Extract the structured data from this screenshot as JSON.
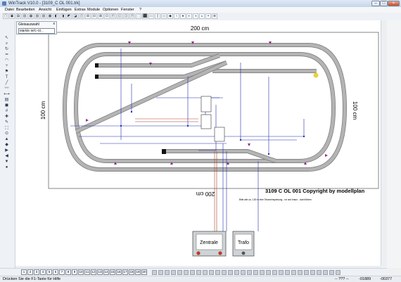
{
  "window": {
    "title": "WinTrack V10.0 - [3109_C OL 001.trk]"
  },
  "menu": [
    "Datei",
    "Bearbeiten",
    "Ansicht",
    "Einfügen",
    "Extras",
    "Module",
    "Optionen",
    "Fenster",
    "?"
  ],
  "panel": {
    "title": "Gleisauswahl",
    "close": "x",
    "selected": "Märklin M/C-Gl..."
  },
  "layout": {
    "dim_top": "200 cm",
    "dim_bottom": "200 cm",
    "dim_left": "100 cm",
    "dim_right": "100 cm",
    "copyright": "3109 C OL 001 Copyright by modellplan",
    "note": "Bitte alle ca. 1,50 m eine Stromeinspeisung - rot und braun - durchführen",
    "box_central": "Zentrale",
    "box_trafo": "Trafo"
  },
  "layers": [
    "1",
    "2",
    "3",
    "4",
    "5",
    "6",
    "7",
    "8",
    "9",
    "10",
    "11",
    "12",
    "13",
    "14",
    "15",
    "16",
    "17",
    "18",
    "19",
    "20"
  ],
  "status": {
    "help": "Drücken Sie die F1-Taste für Hilfe",
    "zoom": "-- ??? --",
    "coord_x": "-01889",
    "coord_y": "-00377"
  },
  "colors": {
    "track": "#a9a9a9",
    "track_edge": "#555555",
    "wire_blue": "#1f2fb3",
    "wire_red": "#c0392b",
    "wire_brown": "#8b4a2b",
    "signal": "#8e2a8c"
  },
  "icons": {
    "window_buttons": [
      "minimize-icon",
      "maximize-icon",
      "close-icon"
    ],
    "left_tools": [
      "pointer-icon",
      "zoom-icon",
      "rotate-icon",
      "track-straight-icon",
      "track-curve-icon",
      "switch-icon",
      "signal-icon",
      "text-icon",
      "line-icon",
      "wire-icon",
      "measure-icon",
      "layer-icon",
      "color-icon",
      "grid-icon"
    ]
  }
}
